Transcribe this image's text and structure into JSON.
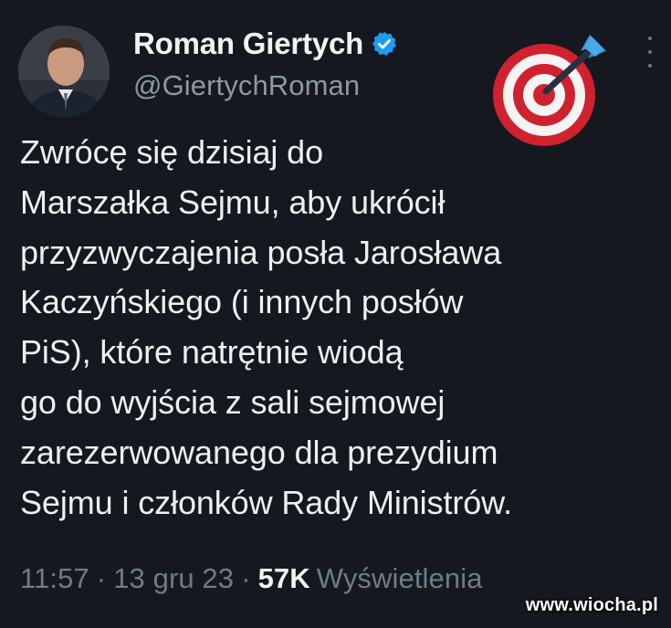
{
  "author": {
    "display_name": "Roman Giertych",
    "handle": "@GiertychRoman",
    "verified": true
  },
  "icons": {
    "verified": "verified-badge-icon",
    "more": "more-options-icon",
    "emoji": "direct-hit-target-emoji"
  },
  "tweet": {
    "lines": [
      "Zwrócę się dzisiaj do",
      "Marszałka Sejmu, aby ukrócił",
      "przyzwyczajenia posła Jarosława",
      "Kaczyńskiego (i innych posłów",
      "PiS), które natrętnie wiodą",
      "go do wyjścia z sali sejmowej",
      "zarezerwowanego dla prezydium",
      "Sejmu i członków Rady Ministrów."
    ]
  },
  "meta": {
    "time": "11:57",
    "separator": "·",
    "date": "13 gru 23",
    "views_count": "57K",
    "views_label": "Wyświetlenia"
  },
  "watermark": "www.wiocha.pl",
  "colors": {
    "background": "#15191f",
    "verified_blue": "#1d9bf0",
    "secondary_text": "#8b98a5"
  }
}
